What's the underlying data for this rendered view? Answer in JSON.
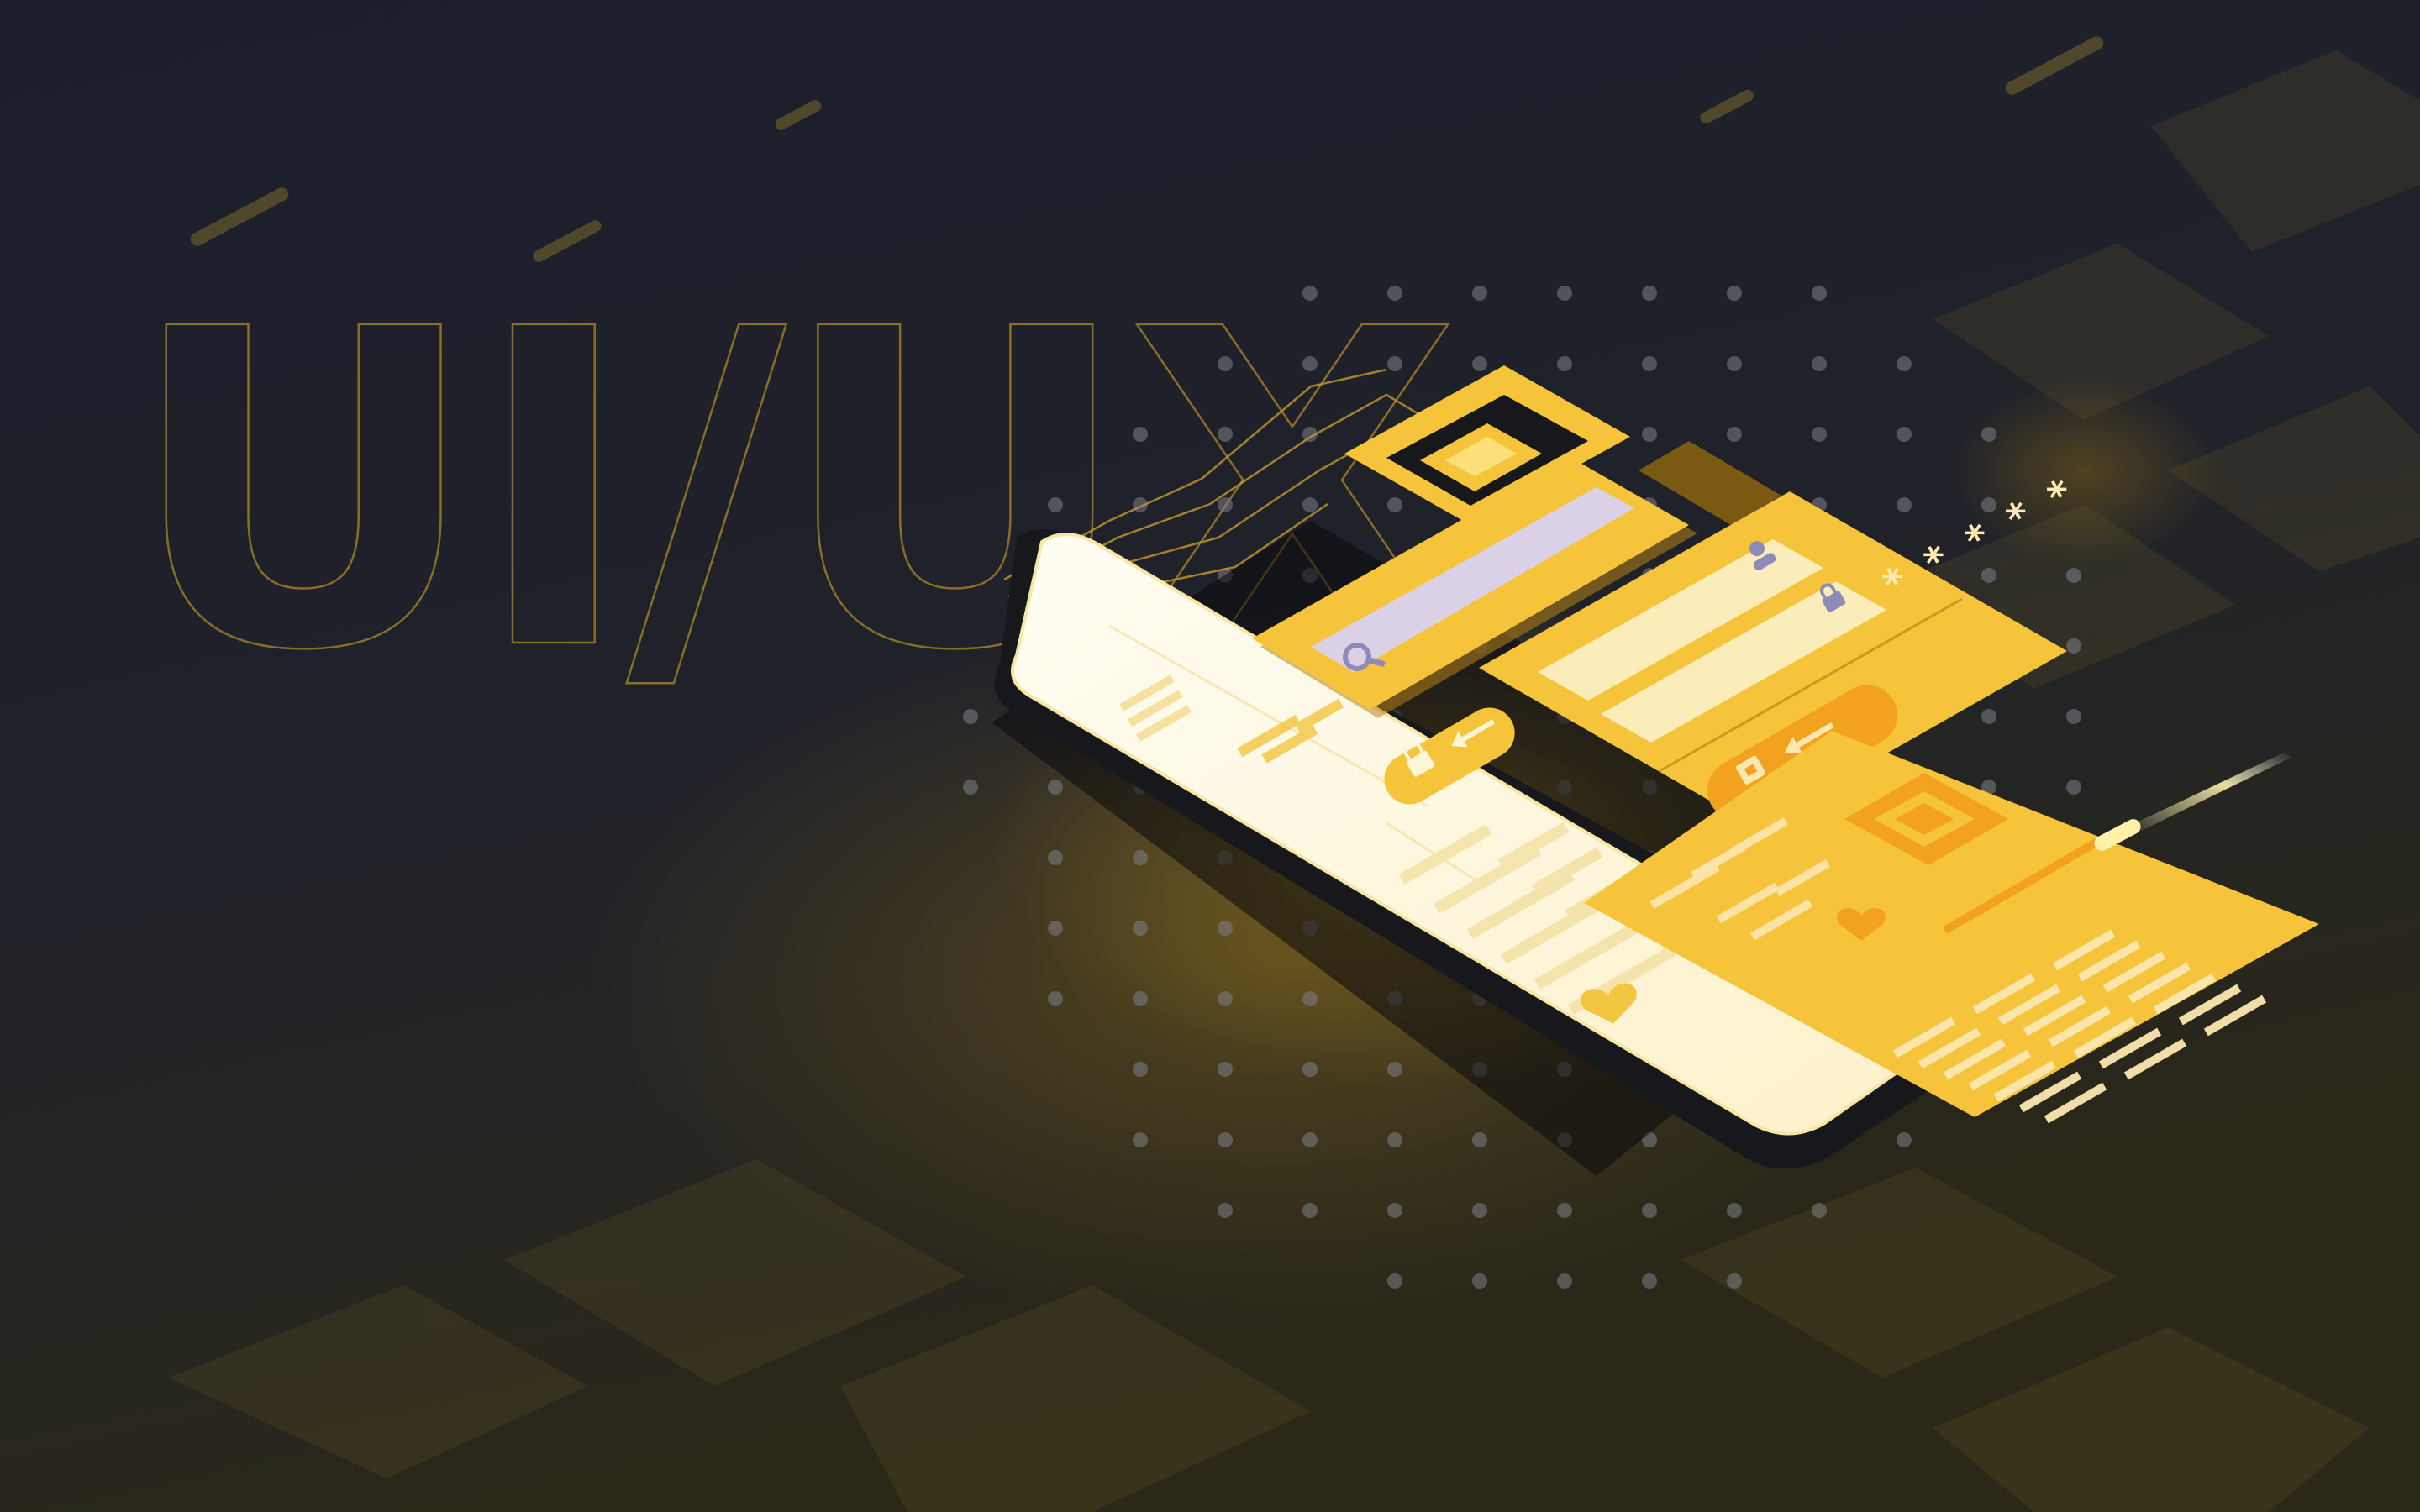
{
  "headline": "UI/UX",
  "password_mask": "* * * * *",
  "colors": {
    "background_top": "#1c2130",
    "background_bottom": "#2a2616",
    "accent": "#f6c43a",
    "accent_deep": "#f2a21f",
    "panel_light": "#fbedb9",
    "screen": "#fffbea",
    "phone_body": "#16171b",
    "outline": "#b08a2c"
  },
  "icons": [
    "search-icon",
    "user-icon",
    "lock-icon",
    "arrow-left-icon",
    "heart-icon",
    "image-placeholder-icon"
  ]
}
